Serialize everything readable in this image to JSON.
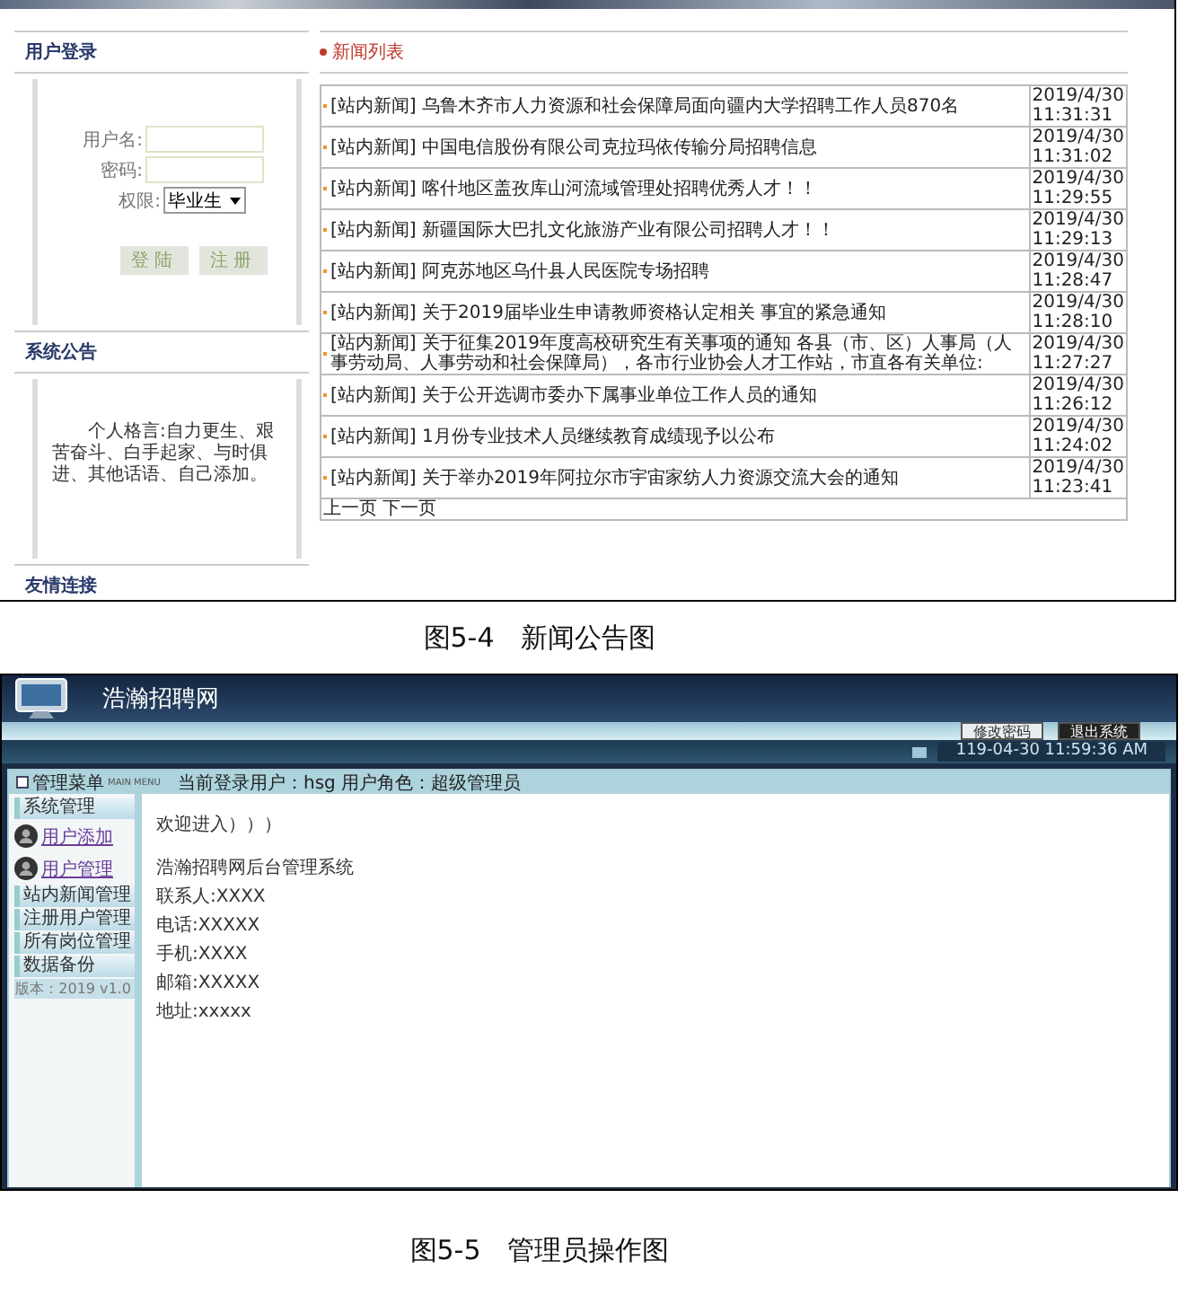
{
  "figure_1": {
    "login": {
      "title": "用户登录",
      "fields": [
        {
          "label": "用户名:"
        },
        {
          "label": "密码:"
        }
      ],
      "role_label": "权限:",
      "role_value": "毕业生",
      "buttons": [
        "登陆",
        "注册"
      ]
    },
    "notice": {
      "title": "系统公告",
      "text": "个人格言:自力更生、艰苦奋斗、白手起家、与时俱进、其他话语、自己添加。"
    },
    "links_title": "友情连接",
    "news": {
      "title": "新闻列表",
      "rows": [
        {
          "tag": "[站内新闻]",
          "title": "乌鲁木齐市人力资源和社会保障局面向疆内大学招聘工作人员870名",
          "date": "2019/4/30",
          "time": "11:31:31"
        },
        {
          "tag": "[站内新闻]",
          "title": "中国电信股份有限公司克拉玛依传输分局招聘信息",
          "date": "2019/4/30",
          "time": "11:31:02"
        },
        {
          "tag": "[站内新闻]",
          "title": "喀什地区盖孜库山河流域管理处招聘优秀人才！！",
          "date": "2019/4/30",
          "time": "11:29:55"
        },
        {
          "tag": "[站内新闻]",
          "title": "新疆国际大巴扎文化旅游产业有限公司招聘人才！！",
          "date": "2019/4/30",
          "time": "11:29:13"
        },
        {
          "tag": "[站内新闻]",
          "title": "阿克苏地区乌什县人民医院专场招聘",
          "date": "2019/4/30",
          "time": "11:28:47"
        },
        {
          "tag": "[站内新闻]",
          "title": "关于2019届毕业生申请教师资格认定相关 事宜的紧急通知",
          "date": "2019/4/30",
          "time": "11:28:10"
        },
        {
          "tag": "[站内新闻]",
          "title": "关于征集2019年度高校研究生有关事项的通知 各县（市、区）人事局（人事劳动局、人事劳动和社会保障局），各市行业协会人才工作站，市直各有关单位:",
          "date": "2019/4/30",
          "time": "11:27:27"
        },
        {
          "tag": "[站内新闻]",
          "title": "关于公开选调市委办下属事业单位工作人员的通知",
          "date": "2019/4/30",
          "time": "11:26:12"
        },
        {
          "tag": "[站内新闻]",
          "title": "1月份专业技术人员继续教育成绩现予以公布",
          "date": "2019/4/30",
          "time": "11:24:02"
        },
        {
          "tag": "[站内新闻]",
          "title": "关于举办2019年阿拉尔市宇宙家纺人力资源交流大会的通知",
          "date": "2019/4/30",
          "time": "11:23:41"
        }
      ],
      "pager": [
        "上一页",
        "下一页"
      ]
    }
  },
  "caption_1": "图5-4　新闻公告图",
  "figure_2": {
    "site_title": "浩瀚招聘网",
    "header_buttons": [
      "修改密码",
      "退出系统"
    ],
    "datetime": "119-04-30 11:59:36 AM",
    "menu_title": "管理菜单",
    "menu_subtitle": "MAIN MENU",
    "current_user": "当前登录用户：hsg 用户角色：超级管理员",
    "sidebar": [
      {
        "kind": "section",
        "label": "系统管理"
      },
      {
        "kind": "link",
        "label": "用户添加"
      },
      {
        "kind": "link",
        "label": "用户管理"
      },
      {
        "kind": "section",
        "label": "站内新闻管理"
      },
      {
        "kind": "section",
        "label": "注册用户管理"
      },
      {
        "kind": "section",
        "label": "所有岗位管理"
      },
      {
        "kind": "section",
        "label": "数据备份"
      },
      {
        "kind": "version",
        "label": "版本：2019 v1.0"
      }
    ],
    "content": [
      "欢迎进入）））",
      "浩瀚招聘网后台管理系统",
      "联系人:XXXX",
      "电话:XXXXX",
      "手机:XXXX",
      "邮箱:XXXXX",
      "地址:xxxxx"
    ]
  },
  "caption_2": "图5-5　管理员操作图"
}
